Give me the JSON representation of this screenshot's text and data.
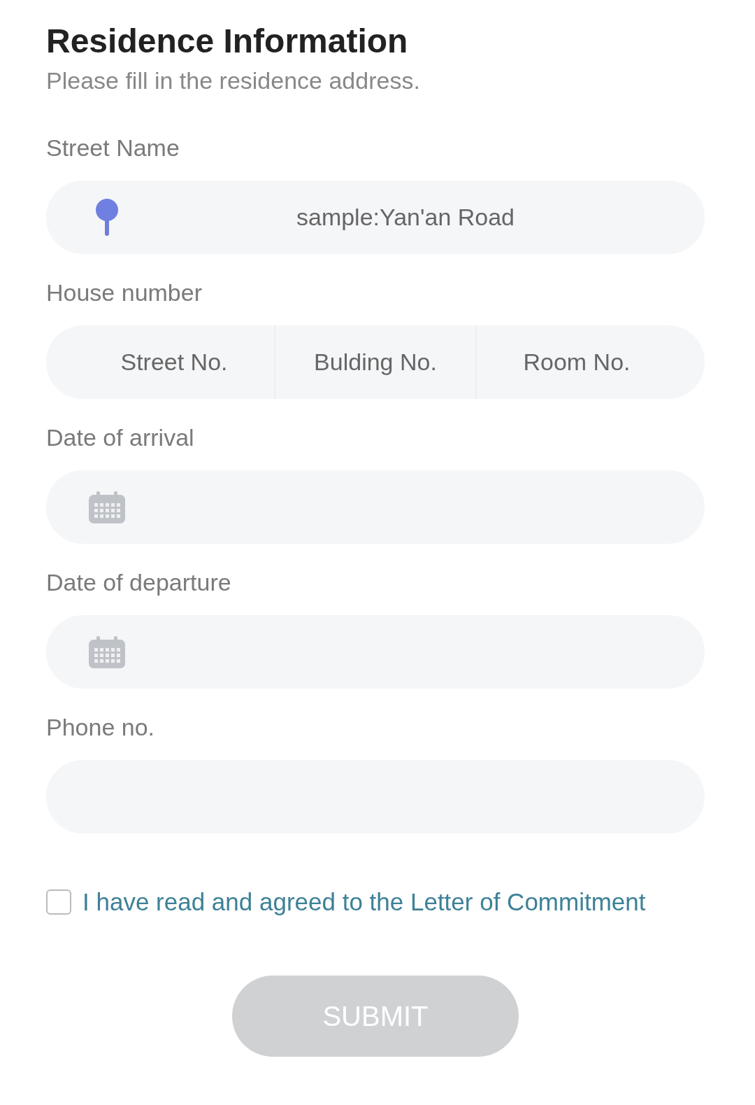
{
  "title": "Residence Information",
  "subtitle": "Please fill in the residence address.",
  "fields": [
    {
      "kind": "location",
      "label": "Street Name",
      "placeholder": "sample:Yan'an Road"
    },
    {
      "kind": "split",
      "label": "House number",
      "parts": [
        {
          "placeholder": "Street No."
        },
        {
          "placeholder": "Bulding No."
        },
        {
          "placeholder": "Room No."
        }
      ]
    },
    {
      "kind": "date",
      "label": "Date of arrival"
    },
    {
      "kind": "date",
      "label": "Date of departure"
    },
    {
      "kind": "plain",
      "label": "Phone no."
    }
  ],
  "agreement": {
    "checked": false,
    "text": "I have read and agreed to the Letter of Commitment"
  },
  "submit": {
    "label": "SUBMIT",
    "disabled": true
  }
}
